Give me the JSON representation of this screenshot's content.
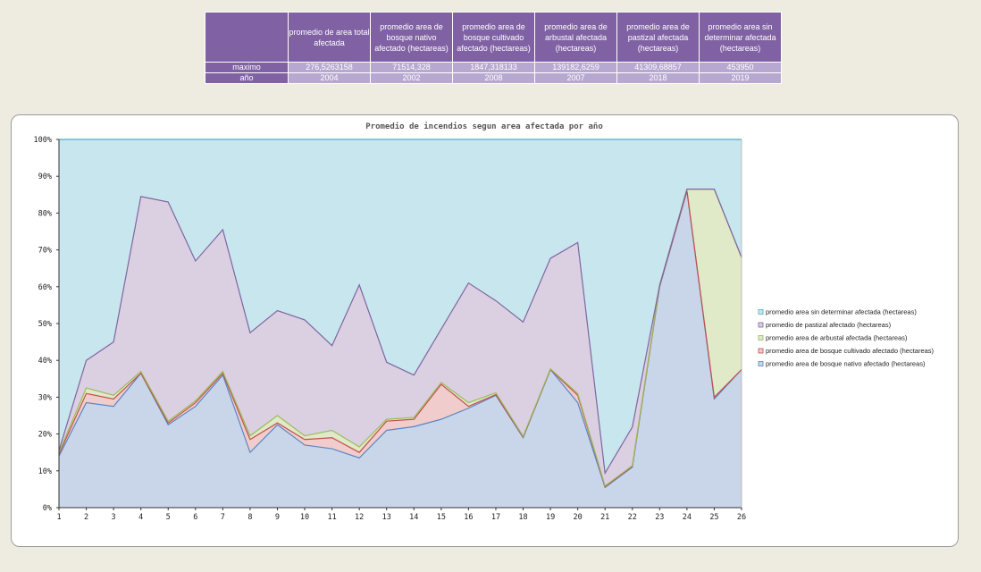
{
  "table": {
    "headers": [
      "promedio de area total afectada",
      "promedio area de bosque nativo afectado (hectareas)",
      "promedio area de bosque cultivado afectado (hectareas)",
      "promedio area de arbustal afectada (hectareas)",
      "promedio area de pastizal afectada (hectareas)",
      "promedio area sin determinar afectada (hectareas)"
    ],
    "rows": [
      {
        "label": "maximo",
        "values": [
          "276,5263158",
          "71514,328",
          "1847,318133",
          "139182,6259",
          "41309,68857",
          "453950"
        ]
      },
      {
        "label": "año",
        "values": [
          "2004",
          "2002",
          "2008",
          "2007",
          "2018",
          "2019"
        ]
      }
    ]
  },
  "chart_data": {
    "type": "area",
    "stacked_percent": true,
    "title": "Promedio de incendios segun area afectada por año",
    "x": [
      1,
      2,
      3,
      4,
      5,
      6,
      7,
      8,
      9,
      10,
      11,
      12,
      13,
      14,
      15,
      16,
      17,
      18,
      19,
      20,
      21,
      22,
      23,
      24,
      25,
      26
    ],
    "ylim": [
      0,
      100
    ],
    "yticks": [
      "0%",
      "10%",
      "20%",
      "30%",
      "40%",
      "50%",
      "60%",
      "70%",
      "80%",
      "90%",
      "100%"
    ],
    "grid": true,
    "legend_position": "right",
    "series": [
      {
        "name": "promedio area de bosque nativo afectado (hectareas)",
        "color": "#c9d6ea",
        "line": "#5a86c4",
        "values": [
          14,
          28.5,
          27.5,
          36.5,
          22.5,
          27.5,
          36,
          15,
          22.5,
          17,
          16,
          13.5,
          21,
          22,
          24,
          27,
          30.5,
          19,
          37.5,
          28.5,
          5.5,
          11,
          60,
          86,
          29.5,
          37.5
        ]
      },
      {
        "name": "promedio area de bosque cultivado afectado (hectareas)",
        "color": "#f0cccc",
        "line": "#c0504d",
        "values": [
          0.5,
          2.5,
          2,
          0,
          0.5,
          1,
          0.5,
          3.5,
          0.5,
          1.5,
          3,
          1.5,
          2.5,
          2,
          9.5,
          0.5,
          0.2,
          0.2,
          0,
          2,
          0.2,
          0.2,
          0.2,
          0,
          0.5,
          0
        ]
      },
      {
        "name": "promedio area de arbustal afectada (hectareas)",
        "color": "#e0e9c8",
        "line": "#9bbb59",
        "values": [
          0.5,
          1.5,
          1,
          0.5,
          0.5,
          0.5,
          0.5,
          1,
          2,
          1,
          2,
          1.5,
          0.5,
          0.5,
          0.5,
          1,
          0.5,
          0.2,
          0.2,
          0.5,
          0.2,
          0.2,
          0.2,
          0.5,
          56.5,
          30.5
        ]
      },
      {
        "name": "promedio de pastizal afectado (hectareas)",
        "color": "#dad0e2",
        "line": "#8064a2",
        "values": [
          0.5,
          7.5,
          14.5,
          47.5,
          59.5,
          38,
          38.5,
          28,
          28.5,
          31.5,
          23,
          44,
          15.5,
          11.5,
          14.5,
          32.5,
          25,
          31,
          30,
          41,
          3.5,
          10.5,
          0,
          0,
          0,
          0
        ]
      },
      {
        "name": "promedio area sin determinar afectada (hectareas)",
        "color": "#c8e6ee",
        "line": "#4bacc6",
        "values": [
          84.5,
          60,
          55,
          15.5,
          17,
          33,
          24.5,
          52.5,
          46.5,
          49,
          56,
          39.5,
          60.5,
          64,
          51.5,
          39,
          43.8,
          49.6,
          32.3,
          28,
          90.6,
          78.1,
          39.6,
          13.5,
          13.5,
          32
        ]
      }
    ],
    "legend_order": [
      4,
      3,
      2,
      1,
      0
    ]
  }
}
